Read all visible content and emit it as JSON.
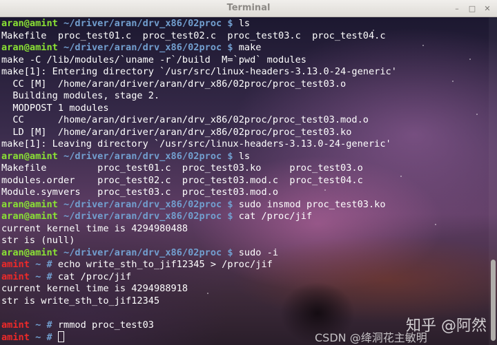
{
  "window": {
    "title": "Terminal",
    "buttons": {
      "minimize": "–",
      "maximize": "□",
      "close": "✕"
    }
  },
  "colors": {
    "prompt_user": "#8ae234",
    "prompt_path": "#729fcf",
    "root_prompt": "#ef2929",
    "text": "#ffffff"
  },
  "terminal": {
    "lines": [
      {
        "type": "user",
        "host": "aran@amint",
        "path": " ~/driver/aran/drv_x86/02proc $ ",
        "cmd": "ls"
      },
      {
        "type": "out",
        "text": "Makefile  proc_test01.c  proc_test02.c  proc_test03.c  proc_test04.c"
      },
      {
        "type": "user",
        "host": "aran@amint",
        "path": " ~/driver/aran/drv_x86/02proc $ ",
        "cmd": "make"
      },
      {
        "type": "out",
        "text": "make -C /lib/modules/`uname -r`/build  M=`pwd` modules"
      },
      {
        "type": "out",
        "text": "make[1]: Entering directory `/usr/src/linux-headers-3.13.0-24-generic'"
      },
      {
        "type": "out",
        "text": "  CC [M]  /home/aran/driver/aran/drv_x86/02proc/proc_test03.o"
      },
      {
        "type": "out",
        "text": "  Building modules, stage 2."
      },
      {
        "type": "out",
        "text": "  MODPOST 1 modules"
      },
      {
        "type": "out",
        "text": "  CC      /home/aran/driver/aran/drv_x86/02proc/proc_test03.mod.o"
      },
      {
        "type": "out",
        "text": "  LD [M]  /home/aran/driver/aran/drv_x86/02proc/proc_test03.ko"
      },
      {
        "type": "out",
        "text": "make[1]: Leaving directory `/usr/src/linux-headers-3.13.0-24-generic'"
      },
      {
        "type": "user",
        "host": "aran@amint",
        "path": " ~/driver/aran/drv_x86/02proc $ ",
        "cmd": "ls"
      },
      {
        "type": "out",
        "text": "Makefile         proc_test01.c  proc_test03.ko     proc_test03.o"
      },
      {
        "type": "out",
        "text": "modules.order    proc_test02.c  proc_test03.mod.c  proc_test04.c"
      },
      {
        "type": "out",
        "text": "Module.symvers   proc_test03.c  proc_test03.mod.o"
      },
      {
        "type": "user",
        "host": "aran@amint",
        "path": " ~/driver/aran/drv_x86/02proc $ ",
        "cmd": "sudo insmod proc_test03.ko"
      },
      {
        "type": "user",
        "host": "aran@amint",
        "path": " ~/driver/aran/drv_x86/02proc $ ",
        "cmd": "cat /proc/jif"
      },
      {
        "type": "out",
        "text": "current kernel time is 4294980488"
      },
      {
        "type": "out",
        "text": "str is (null)"
      },
      {
        "type": "user",
        "host": "aran@amint",
        "path": " ~/driver/aran/drv_x86/02proc $ ",
        "cmd": "sudo -i"
      },
      {
        "type": "root",
        "host": "amint",
        "path": " ~ # ",
        "cmd": "echo write_sth_to_jif12345 > /proc/jif"
      },
      {
        "type": "root",
        "host": "amint",
        "path": " ~ # ",
        "cmd": "cat /proc/jif"
      },
      {
        "type": "out",
        "text": "current kernel time is 4294988918"
      },
      {
        "type": "out",
        "text": "str is write_sth_to_jif12345"
      },
      {
        "type": "out",
        "text": ""
      },
      {
        "type": "root",
        "host": "amint",
        "path": " ~ # ",
        "cmd": "rmmod proc_test03"
      },
      {
        "type": "root",
        "host": "amint",
        "path": " ~ # ",
        "cmd": "",
        "cursor": true
      }
    ]
  },
  "watermark": {
    "logo": "知乎 @阿然",
    "caption": "CSDN @绛洞花主敏明"
  }
}
